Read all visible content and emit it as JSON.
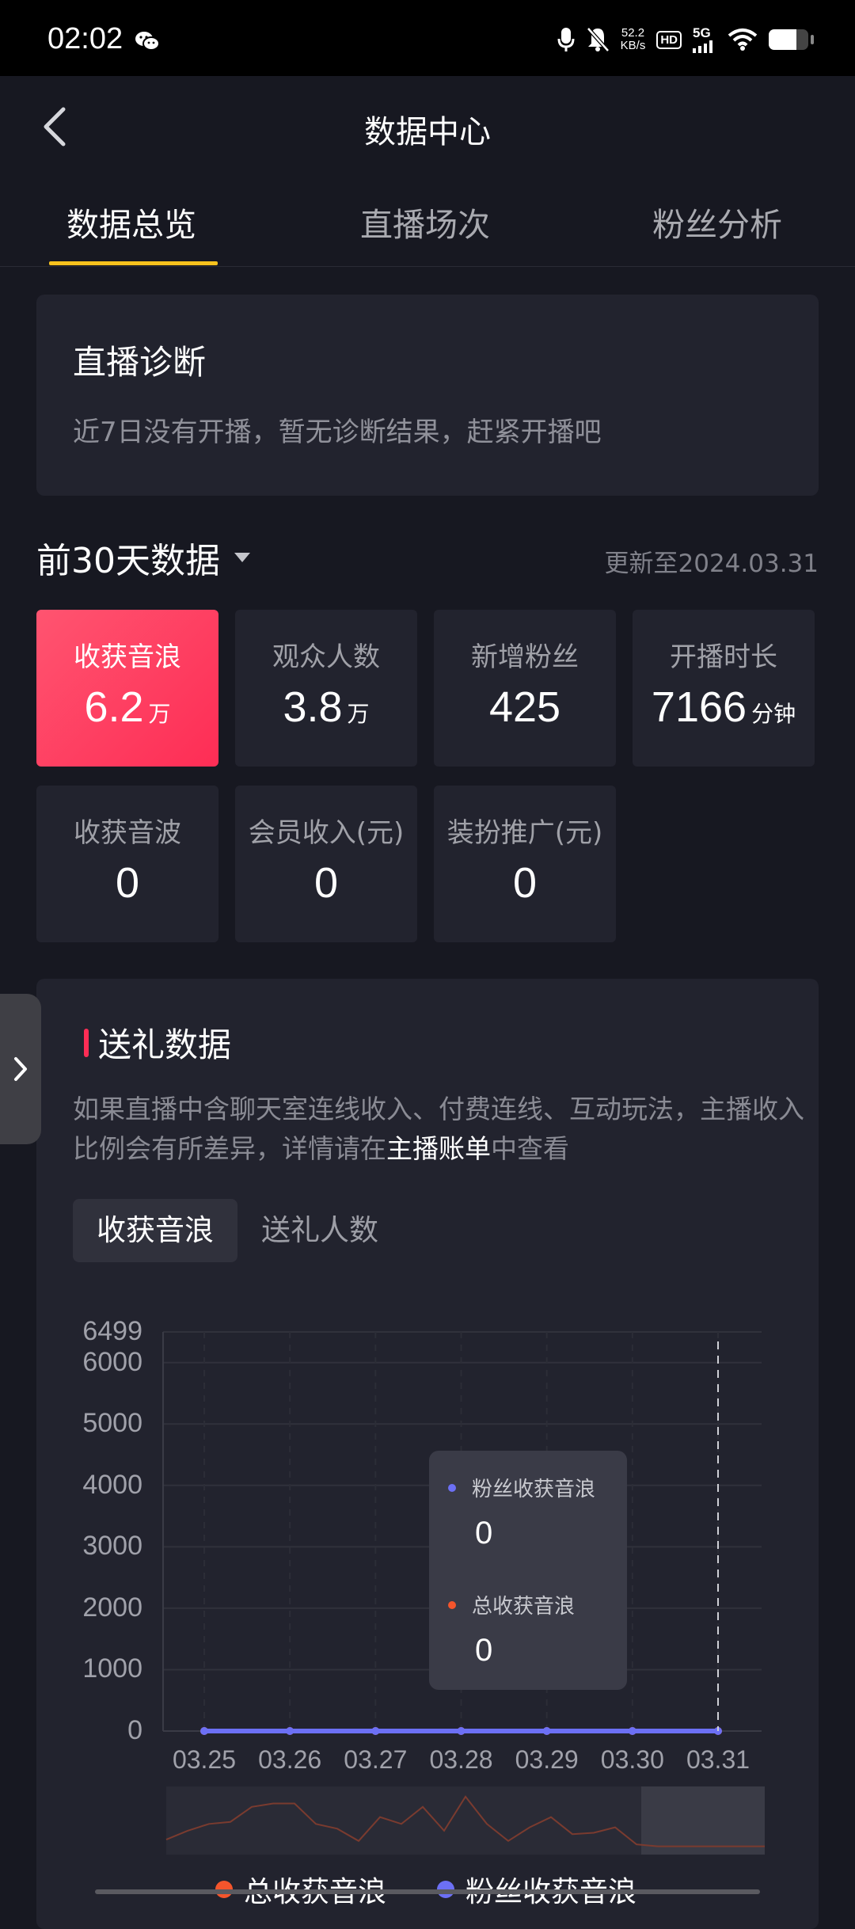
{
  "status_bar": {
    "time": "02:02",
    "net_speed_value": "52.2",
    "net_speed_unit": "KB/s",
    "hd": "HD",
    "network": "5G",
    "battery_level": 0.7
  },
  "nav": {
    "title": "数据中心"
  },
  "tabs": [
    {
      "label": "数据总览",
      "active": true
    },
    {
      "label": "直播场次",
      "active": false
    },
    {
      "label": "粉丝分析",
      "active": false
    }
  ],
  "diagnosis": {
    "title": "直播诊断",
    "text": "近7日没有开播，暂无诊断结果，赶紧开播吧"
  },
  "period": {
    "label": "前30天数据",
    "updated": "更新至2024.03.31"
  },
  "metrics": [
    {
      "label": "收获音浪",
      "value": "6.2",
      "unit": "万"
    },
    {
      "label": "观众人数",
      "value": "3.8",
      "unit": "万"
    },
    {
      "label": "新增粉丝",
      "value": "425",
      "unit": ""
    },
    {
      "label": "开播时长",
      "value": "7166",
      "unit": "分钟"
    },
    {
      "label": "收获音波",
      "value": "0",
      "unit": ""
    },
    {
      "label": "会员收入(元)",
      "value": "0",
      "unit": ""
    },
    {
      "label": "装扮推广(元)",
      "value": "0",
      "unit": ""
    }
  ],
  "gift": {
    "title": "送礼数据",
    "desc_prefix": "如果直播中含聊天室连线收入、付费连线、互动玩法，主播收入比例会有所差异，详情请在",
    "desc_link": "主播账单",
    "desc_suffix": "中查看",
    "tab_active": "收获音浪",
    "tab_inactive": "送礼人数"
  },
  "colors": {
    "accent_tab": "#f8c21d",
    "highlight": "#fe2d55",
    "series_fans": "#6c70f5",
    "series_total": "#f4552c"
  },
  "chart_data": {
    "type": "line",
    "categories": [
      "03.25",
      "03.26",
      "03.27",
      "03.28",
      "03.29",
      "03.30",
      "03.31"
    ],
    "y_ticks": [
      "6499",
      "6000",
      "5000",
      "4000",
      "3000",
      "2000",
      "1000",
      "0"
    ],
    "ylim": [
      0,
      6499
    ],
    "series": [
      {
        "name": "总收获音浪",
        "values": [
          0,
          0,
          0,
          0,
          0,
          0,
          0
        ]
      },
      {
        "name": "粉丝收获音浪",
        "values": [
          0,
          0,
          0,
          0,
          0,
          0,
          0
        ]
      }
    ],
    "tooltip": {
      "series1_name": "粉丝收获音浪",
      "series1_value": "0",
      "series2_name": "总收获音浪",
      "series2_value": "0"
    },
    "overview_trend": [
      0.22,
      0.35,
      0.45,
      0.48,
      0.7,
      0.75,
      0.75,
      0.45,
      0.38,
      0.2,
      0.55,
      0.45,
      0.7,
      0.35,
      0.85,
      0.45,
      0.2,
      0.4,
      0.55,
      0.3,
      0.32,
      0.4,
      0.15,
      0.12,
      0.12,
      0.12,
      0.12,
      0.12,
      0.12
    ],
    "grid": true,
    "legend_position": "bottom"
  }
}
